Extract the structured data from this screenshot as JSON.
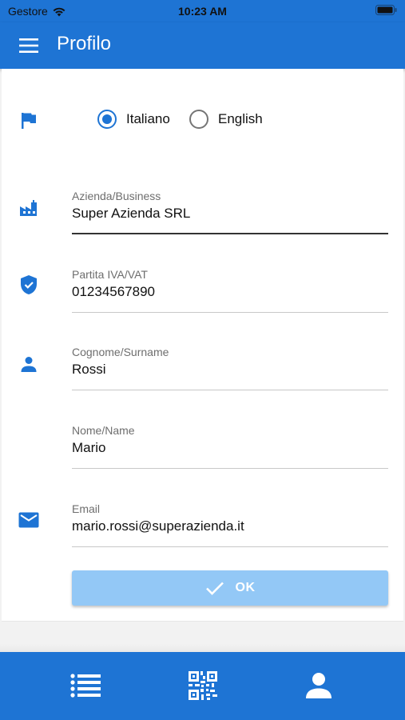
{
  "status_bar": {
    "carrier": "Gestore",
    "time": "10:23 AM"
  },
  "app_bar": {
    "title": "Profilo",
    "menu_icon": "menu-icon"
  },
  "language": {
    "icon": "flag-icon",
    "options": [
      {
        "label": "Italiano",
        "selected": true
      },
      {
        "label": "English",
        "selected": false
      }
    ]
  },
  "form": {
    "company": {
      "label": "Azienda/Business",
      "value": "Super Azienda SRL",
      "icon": "factory-icon"
    },
    "vat": {
      "label": "Partita IVA/VAT",
      "value": "01234567890",
      "icon": "verified-shield-icon"
    },
    "surname": {
      "label": "Cognome/Surname",
      "value": "Rossi",
      "icon": "person-icon"
    },
    "name": {
      "label": "Nome/Name",
      "value": "Mario"
    },
    "email": {
      "label": "Email",
      "value": "mario.rossi@superazienda.it",
      "icon": "mail-icon"
    }
  },
  "ok_button": {
    "label": "OK",
    "icon": "check-icon"
  },
  "bottom_nav": {
    "items": [
      "list-icon",
      "qr-code-icon",
      "person-icon"
    ]
  },
  "colors": {
    "primary": "#1e74d4",
    "button_disabled": "#93c8f6"
  }
}
